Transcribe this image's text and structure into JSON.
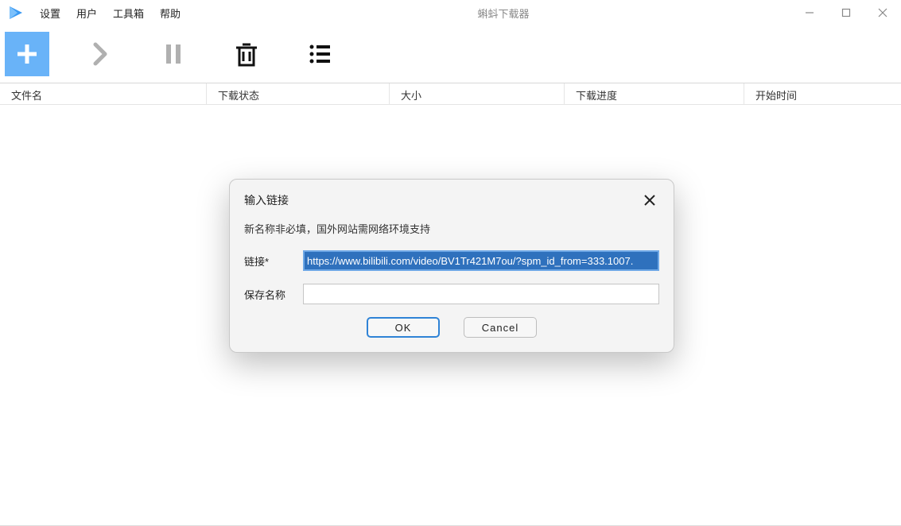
{
  "window": {
    "title": "蝌蚪下载器"
  },
  "menu": {
    "settings": "设置",
    "user": "用户",
    "toolbox": "工具箱",
    "help": "帮助"
  },
  "table": {
    "headers": {
      "filename": "文件名",
      "status": "下载状态",
      "size": "大小",
      "progress": "下载进度",
      "start_time": "开始时间"
    }
  },
  "dialog": {
    "title": "输入链接",
    "hint": "新名称非必填，国外网站需网络环境支持",
    "link_label": "链接*",
    "link_value": "https://www.bilibili.com/video/BV1Tr421M7ou/?spm_id_from=333.1007.",
    "name_label": "保存名称",
    "name_value": "",
    "ok": "OK",
    "cancel": "Cancel"
  }
}
